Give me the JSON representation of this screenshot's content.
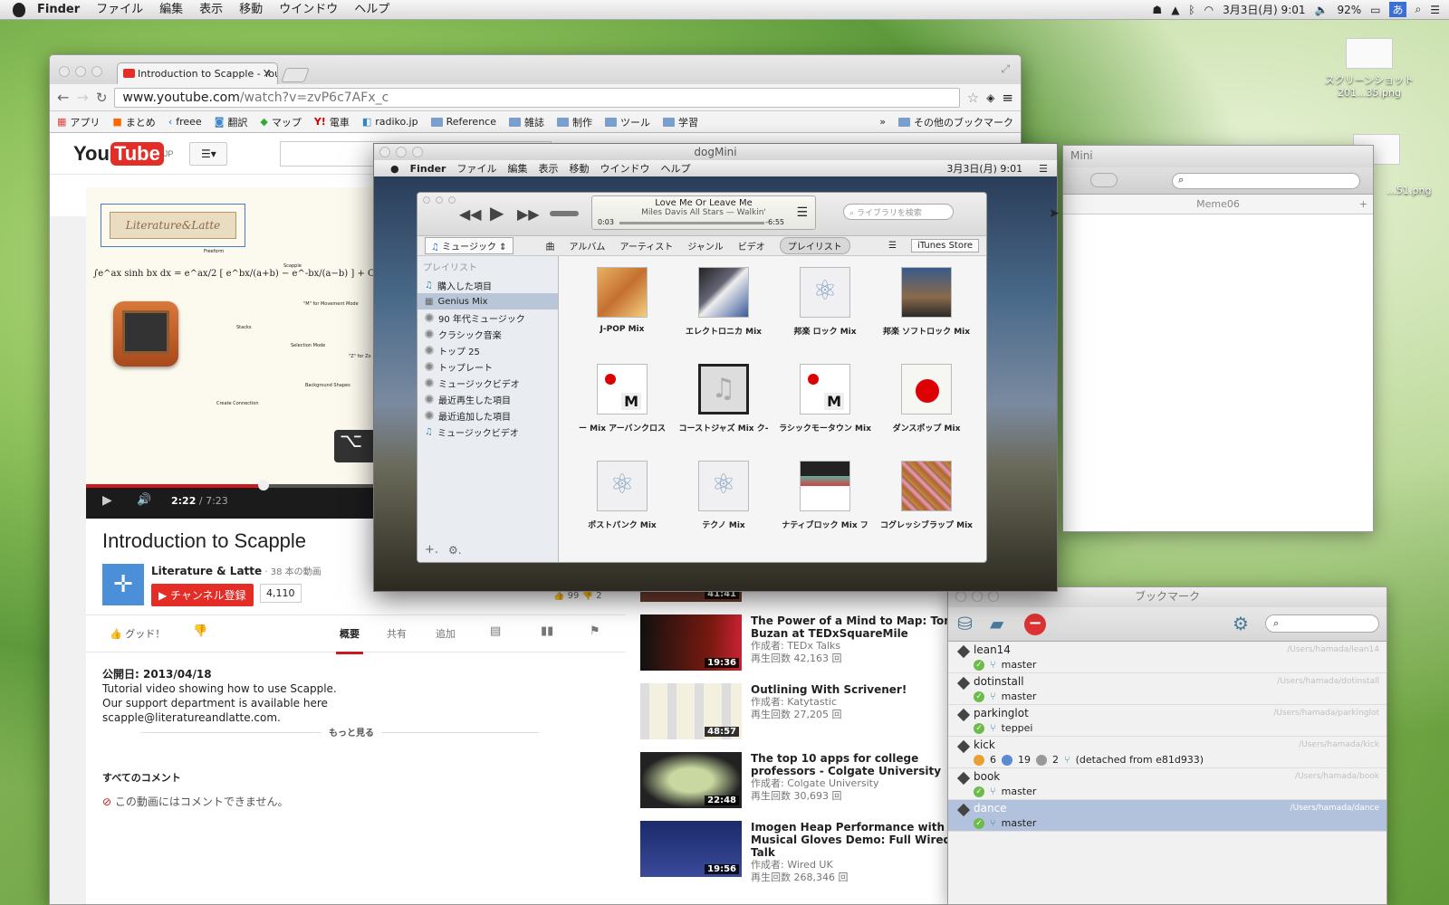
{
  "menubar": {
    "app": "Finder",
    "items": [
      "ファイル",
      "編集",
      "表示",
      "移動",
      "ウインドウ",
      "ヘルプ"
    ],
    "date": "3月3日(月) 9:01",
    "battery": "92%",
    "ime": "あ"
  },
  "desktop": {
    "icon1": "スクリーンショット 201...35.png",
    "icon2": "...51.png"
  },
  "chrome": {
    "tab_title": "Introduction to Scapple - YouTube",
    "url_host": "www.youtube.com",
    "url_path": "/watch?v=zvP6c7AFx_c",
    "bookmarks": [
      "アプリ",
      "まとめ",
      "freee",
      "翻訳",
      "マップ",
      "電車",
      "radiko.jp",
      "Reference",
      "雑誌",
      "制作",
      "ツール",
      "学習"
    ],
    "other_bookmarks": "その他のブックマーク",
    "more": "»"
  },
  "youtube": {
    "logo_you": "You",
    "logo_tube": "Tube",
    "region": "JP",
    "time_current": "2:22",
    "time_total": " / 7:23",
    "video_title": "Introduction to Scapple",
    "channel": "Literature & Latte",
    "video_count": " · 38 本の動画",
    "subscribe": "チャンネル登録",
    "subs": "4,110",
    "likes": "99",
    "dislikes": "2",
    "like_label": "グッド！",
    "tabs": [
      "概要",
      "共有",
      "追加"
    ],
    "published": "公開日: 2013/04/18",
    "desc1": "Tutorial video showing how to use Scapple.",
    "desc2": "Our support department is available here",
    "desc3": "scapple@literatureandlatte.com.",
    "more": "もっと見る",
    "comments_head": "すべてのコメント",
    "comments_off": "この動画にはコメントできません。",
    "overlay_key": "⌥",
    "slide_logo": "Literature&Latte",
    "formula": "∫e^ax sinh bx dx = e^ax/2 [ e^bx/(a+b) − e^-bx/(a−b) ] + C",
    "slide_labels": [
      "Freeform",
      "Scapple",
      "\"M\" for Movement Mode",
      "Stacks",
      "Selection Mode",
      "\"Z\" for Zo",
      "Background Shapes",
      "Create Connection"
    ],
    "related": [
      {
        "title": "The Power of a Mind to Map: Tony Buzan at TEDxSquareMile",
        "by": "作成者: TEDx Talks",
        "views": "再生回数 42,163 回",
        "dur": "19:36"
      },
      {
        "title": "Outlining With Scrivener!",
        "by": "作成者: Katytastic",
        "views": "再生回数 27,205 回",
        "dur": "48:57"
      },
      {
        "title": "The top 10 apps for college professors - Colgate University",
        "by": "作成者: Colgate University",
        "views": "再生回数 30,693 回",
        "dur": "22:48"
      },
      {
        "title": "Imogen Heap Performance with Musical Gloves Demo: Full Wired Talk",
        "by": "作成者: Wired UK",
        "views": "再生回数 268,346 回",
        "dur": "19:56"
      }
    ],
    "partial_dur": "41:41"
  },
  "dogmini": {
    "title": "dogMini",
    "app": "Finder",
    "menu": [
      "ファイル",
      "編集",
      "表示",
      "移動",
      "ウインドウ",
      "ヘルプ"
    ],
    "clock": "3月3日(月) 9:01"
  },
  "itunes": {
    "song": "Love Me Or Leave Me",
    "artist": "Miles Davis All Stars — Walkin'",
    "elapsed": "0:03",
    "remaining": "-6:55",
    "search": "ライブラリを検索",
    "source": "ミュージック",
    "tabs": [
      "曲",
      "アルバム",
      "アーティスト",
      "ジャンル",
      "ビデオ",
      "プレイリスト"
    ],
    "store": "iTunes Store",
    "sidebar_head": "プレイリスト",
    "sidebar": [
      "購入した項目",
      "Genius Mix",
      "90 年代ミュージック",
      "クラシック音楽",
      "トップ 25",
      "トップレート",
      "ミュージックビデオ",
      "最近再生した項目",
      "最近追加した項目",
      "ミュージックビデオ"
    ],
    "albums": [
      "J-POP Mix",
      "エレクトロニカ Mix",
      "邦楽 ロック Mix",
      "邦楽 ソフトロック Mix",
      "ー Mix  アーバンクロス",
      "コーストジャズ Mix  ク-",
      "ラシックモータウン Mix",
      "ダンスポップ Mix",
      "ポストパンク Mix",
      "テクノ Mix",
      "ナティブロック Mix  フ",
      "コグレッシブラップ Mix"
    ]
  },
  "meme": {
    "title": "Meme06",
    "title_partial": "Mini"
  },
  "bookmarkwin": {
    "title": "ブックマーク",
    "repos": [
      {
        "name": "lean14",
        "path": "/Users/hamada/lean14",
        "branch": "master"
      },
      {
        "name": "dotinstall",
        "path": "/Users/hamada/dotinstall",
        "branch": "master"
      },
      {
        "name": "parkinglot",
        "path": "/Users/hamada/parkinglot",
        "branch": "teppei"
      },
      {
        "name": "kick",
        "path": "/Users/hamada/kick",
        "branch": "(detached from e81d933)",
        "n1": "6",
        "n2": "19",
        "n3": "2"
      },
      {
        "name": "book",
        "path": "/Users/hamada/book",
        "branch": "master"
      },
      {
        "name": "dance",
        "path": "/Users/hamada/dance",
        "branch": "master"
      }
    ]
  }
}
